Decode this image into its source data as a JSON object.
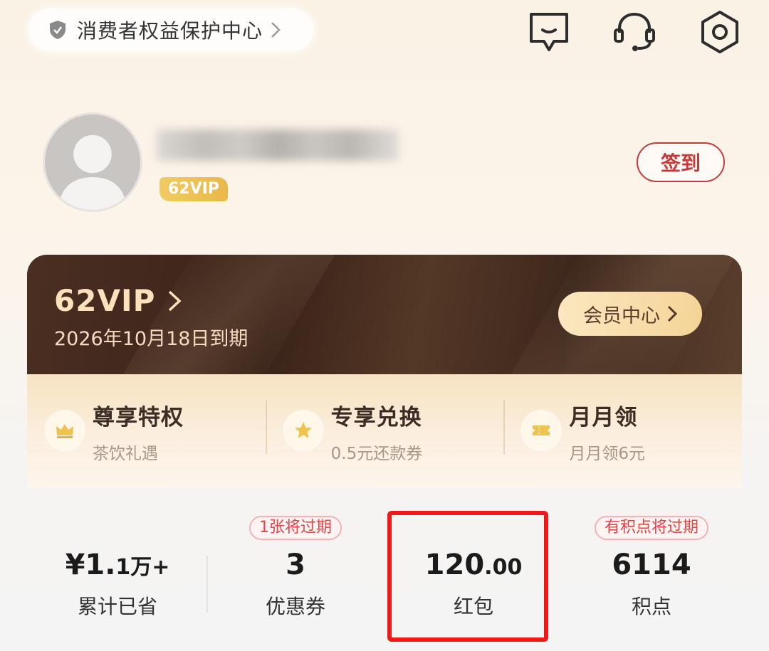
{
  "top_bar": {
    "consumer_center": "消费者权益保护中心",
    "icons": [
      "message-icon",
      "customer-service-icon",
      "settings-icon"
    ]
  },
  "profile": {
    "vip_tag": "62VIP",
    "signin": "签到"
  },
  "vip_card": {
    "level": "62VIP",
    "expire": "2026年10月18日到期",
    "member_center": "会员中心"
  },
  "perks": [
    {
      "title": "尊享特权",
      "sub": "茶饮礼遇",
      "icon": "crown-icon"
    },
    {
      "title": "专享兑换",
      "sub": "0.5元还款券",
      "icon": "star-icon"
    },
    {
      "title": "月月领",
      "sub": "月月领6元",
      "icon": "ticket-icon"
    }
  ],
  "stats": [
    {
      "value_main": "¥1.",
      "value_small": "1万+",
      "label": "累计已省",
      "badge": ""
    },
    {
      "value_main": "3",
      "value_small": "",
      "label": "优惠券",
      "badge": "1张将过期"
    },
    {
      "value_main": "120",
      "value_small": ".00",
      "label": "红包",
      "badge": ""
    },
    {
      "value_main": "6114",
      "value_small": "",
      "label": "积点",
      "badge": "有积点将过期"
    }
  ],
  "colors": {
    "accent_red": "#c83a3a",
    "highlight": "#f01818",
    "vip_gold": "#fbe2bd",
    "card_brown": "#3a2319"
  }
}
